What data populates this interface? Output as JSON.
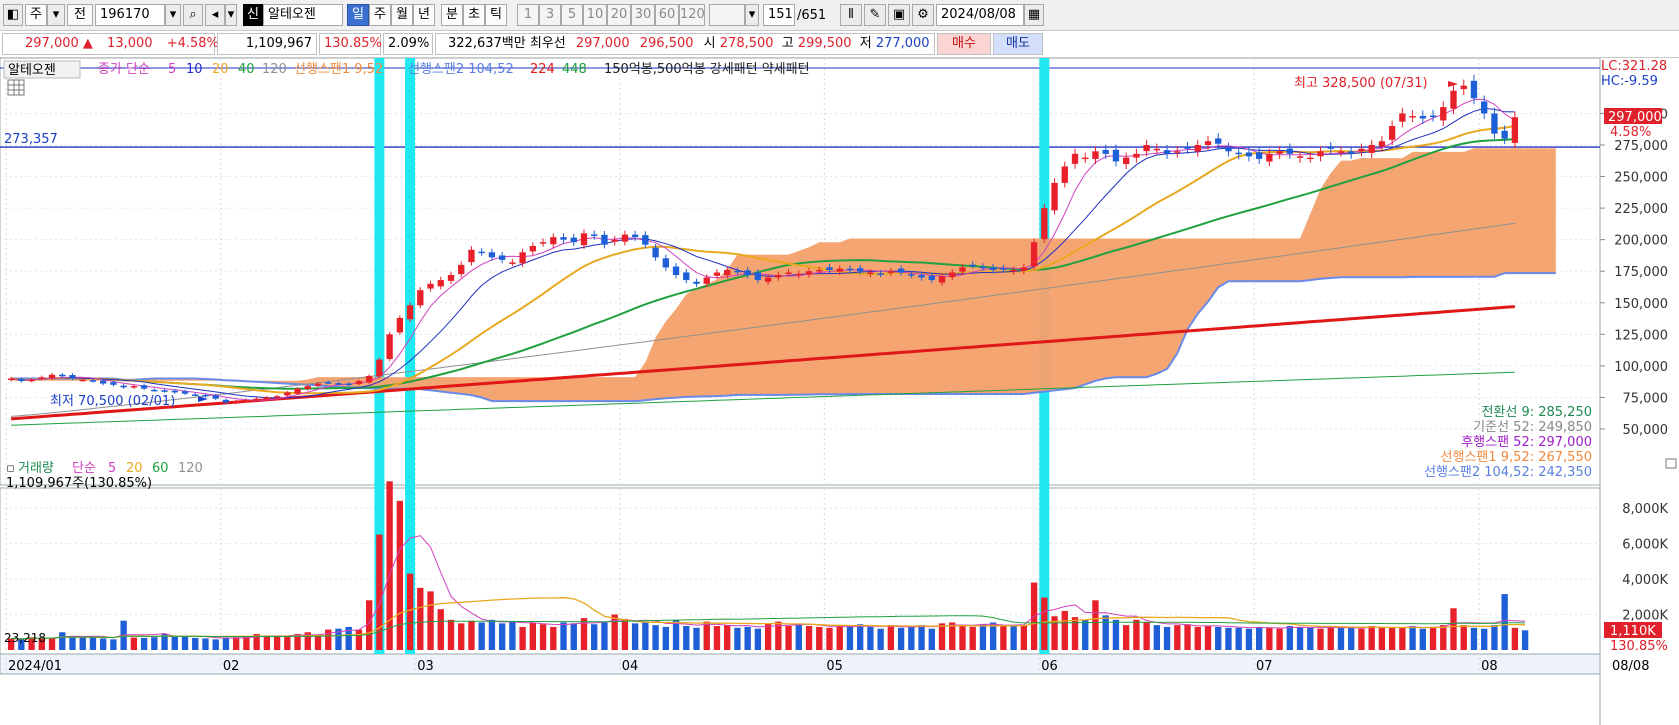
{
  "toolbar": {
    "period_week": "주",
    "prev_label": "전",
    "code": "196170",
    "market_badge": "신",
    "stock_name": "알테오젠",
    "period_tabs": [
      "일",
      "주",
      "월",
      "년",
      "분",
      "초",
      "틱"
    ],
    "interval_buttons": [
      "1",
      "3",
      "5",
      "10",
      "20",
      "30",
      "60",
      "120"
    ],
    "count": "151",
    "total": "/651",
    "date": "2024/08/08"
  },
  "quote": {
    "price": "297,000",
    "change_arrow": "▲",
    "change": "13,000",
    "change_pct": "+4.58%",
    "volume": "1,109,967",
    "volume_ratio": "130.85%",
    "turnover": "2.09%",
    "amount": "322,637백만",
    "best_label": "최우선",
    "ask": "297,000",
    "bid": "296,500",
    "open_label": "시",
    "open": "278,500",
    "high_label": "고",
    "high": "299,500",
    "low_label": "저",
    "low": "277,000",
    "buy": "매수",
    "sell": "매도"
  },
  "legend": {
    "name": "알테오젠",
    "ma_label": "종가 단순",
    "ma_periods": [
      "5",
      "10",
      "20",
      "40",
      "120"
    ],
    "span1": "선행스팬1 9,52",
    "span2": "선행스팬2 104,52",
    "extra1": "224",
    "extra2": "448",
    "pattern": "150억봉,500억봉 강세패턴 약세패턴"
  },
  "volume_legend": {
    "name": "거래량",
    "ma_label": "단순",
    "ma_periods": [
      "5",
      "20",
      "60",
      "120"
    ],
    "current": "1,109,967주(130.85%)",
    "left_tag": "23,218"
  },
  "annotations": {
    "high": "최고 328,500 (07/31)",
    "low": "최저 70,500 (02/01)",
    "hline_value": "273,357",
    "lc": "LC:321.28",
    "hc": "HC:-9.59",
    "price_tag": "297,000",
    "price_tag_pct": "4.58%",
    "vol_tag": "1,110K",
    "vol_tag_pct": "130.85%",
    "x_end": "08/08"
  },
  "ichimoku_legend": [
    {
      "label": "전환선 9: 285,250",
      "color": "#1f8a50"
    },
    {
      "label": "기준선 52: 249,850",
      "color": "#888888"
    },
    {
      "label": "후행스팬 52: 297,000",
      "color": "#a020c8"
    },
    {
      "label": "선행스팬1 9,52: 267,550",
      "color": "#f08a40"
    },
    {
      "label": "선행스팬2 104,52: 242,350",
      "color": "#5a7fe0"
    }
  ],
  "colors": {
    "up": "#e8202a",
    "down": "#1e5fd8",
    "cloud": "#f4a06a",
    "ma5": "#d040c0",
    "ma10": "#2030c0",
    "ma20": "#e8a820",
    "ma40": "#20a040",
    "ma120": "#909090",
    "ma224": "#e01818",
    "ma448": "#20a040",
    "cyan": "#20e8f0"
  },
  "chart_data": [
    {
      "type": "candlestick",
      "title": "알테오젠",
      "x_ticks": [
        "2024/01",
        "02",
        "03",
        "04",
        "05",
        "06",
        "07",
        "08"
      ],
      "y_ticks": [
        "50,000",
        "75,000",
        "100,000",
        "125,000",
        "150,000",
        "175,000",
        "200,000",
        "225,000",
        "250,000",
        "275,000",
        "300,000"
      ],
      "ylim": [
        40000,
        335000
      ],
      "month_index": [
        0,
        21,
        40,
        60,
        80,
        101,
        122,
        144
      ],
      "series": [
        {
          "name": "close",
          "values": [
            90000,
            88000,
            89000,
            91000,
            93000,
            92000,
            90000,
            89000,
            88000,
            86000,
            85000,
            83000,
            84000,
            82000,
            81000,
            80000,
            79000,
            78000,
            77000,
            76000,
            74000,
            71000,
            72000,
            73000,
            74000,
            75000,
            76000,
            79000,
            82000,
            84000,
            86000,
            87000,
            86000,
            85000,
            88000,
            92000,
            105000,
            125000,
            138000,
            148000,
            160000,
            165000,
            168000,
            172000,
            180000,
            192000,
            190000,
            186000,
            184000,
            182000,
            190000,
            195000,
            198000,
            202000,
            200000,
            198000,
            205000,
            203000,
            196000,
            200000,
            204000,
            202000,
            196000,
            186000,
            178000,
            172000,
            168000,
            165000,
            170000,
            174000,
            176000,
            175000,
            172000,
            168000,
            170000,
            172000,
            174000,
            173000,
            175000,
            176000,
            176000,
            177000,
            176000,
            175000,
            174000,
            173000,
            175000,
            174000,
            172000,
            170000,
            168000,
            171000,
            174000,
            178000,
            180000,
            178000,
            176000,
            177000,
            176000,
            178000,
            198000,
            225000,
            245000,
            258000,
            268000,
            265000,
            270000,
            268000,
            262000,
            265000,
            268000,
            275000,
            272000,
            268000,
            270000,
            272000,
            275000,
            278000,
            276000,
            270000,
            268000,
            266000,
            264000,
            268000,
            270000,
            268000,
            266000,
            265000,
            270000,
            272000,
            270000,
            268000,
            272000,
            275000,
            278000,
            290000,
            300000,
            298000,
            296000,
            298000,
            305000,
            318000,
            322000,
            312000,
            300000,
            284000,
            280000,
            297000
          ]
        },
        {
          "name": "기준선 52",
          "values_last": 249850
        },
        {
          "name": "전환선 9",
          "values_last": 285250
        },
        {
          "name": "후행스팬 52",
          "values_last": 297000
        },
        {
          "name": "선행스팬1 9,52",
          "values_last": 267550
        },
        {
          "name": "선행스팬2 104,52",
          "values_last": 242350
        }
      ]
    },
    {
      "type": "bar",
      "title": "거래량",
      "y_ticks": [
        "2,000K",
        "4,000K",
        "6,000K",
        "8,000K"
      ],
      "ylim": [
        0,
        9800
      ],
      "values": [
        650,
        600,
        720,
        700,
        680,
        1000,
        750,
        700,
        720,
        650,
        600,
        1650,
        700,
        680,
        720,
        900,
        800,
        750,
        680,
        650,
        600,
        700,
        720,
        760,
        900,
        820,
        780,
        740,
        900,
        1000,
        850,
        1150,
        1200,
        1300,
        1150,
        2800,
        6500,
        9500,
        8400,
        4300,
        3500,
        3300,
        2300,
        1700,
        1500,
        1650,
        1550,
        1700,
        1500,
        1600,
        1300,
        1550,
        1450,
        1300,
        1550,
        1500,
        1800,
        1450,
        1550,
        2000,
        1750,
        1500,
        1550,
        1400,
        1300,
        1700,
        1350,
        1250,
        1600,
        1350,
        1400,
        1250,
        1300,
        1200,
        1500,
        1600,
        1350,
        1450,
        1350,
        1300,
        1250,
        1350,
        1350,
        1450,
        1300,
        1200,
        1400,
        1250,
        1350,
        1400,
        1200,
        1500,
        1550,
        1400,
        1300,
        1450,
        1550,
        1350,
        1350,
        1400,
        3800,
        2950,
        1900,
        2200,
        1850,
        1700,
        2800,
        1950,
        1700,
        1400,
        1700,
        1550,
        1400,
        1300,
        1400,
        1450,
        1300,
        1350,
        1300,
        1250,
        1250,
        1200,
        1300,
        1250,
        1200,
        1350,
        1300,
        1250,
        1200,
        1250,
        1300,
        1250,
        1200,
        1350,
        1250,
        1300,
        1250,
        1350,
        1200,
        1300,
        1400,
        2350,
        1400,
        1250,
        1200,
        1400,
        3150,
        1250,
        1110
      ],
      "ma_values_last": [
        1110
      ]
    }
  ]
}
